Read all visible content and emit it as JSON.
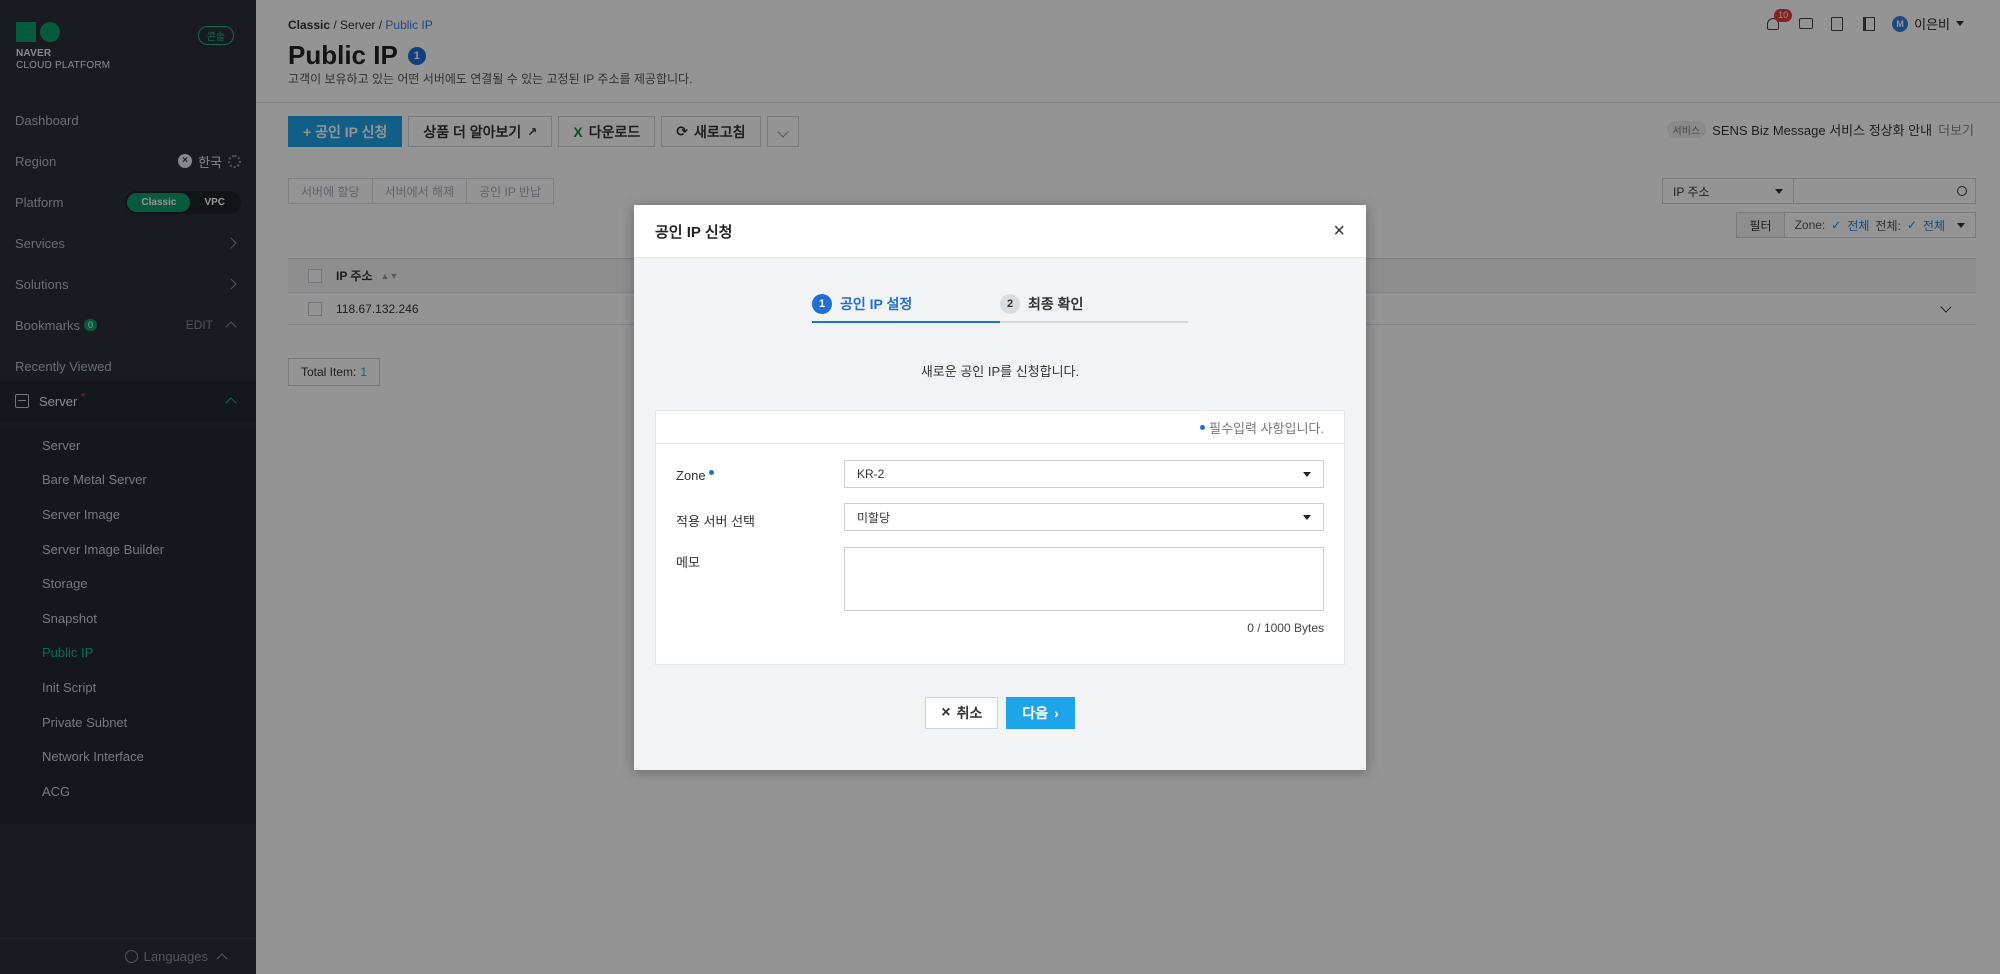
{
  "sidebar": {
    "logo_line1": "NAVER",
    "logo_line2": "CLOUD PLATFORM",
    "console_badge": "콘솔",
    "dashboard": "Dashboard",
    "region_label": "Region",
    "region_value": "한국",
    "platform_label": "Platform",
    "platform_options": [
      "Classic",
      "VPC"
    ],
    "services": "Services",
    "solutions": "Solutions",
    "bookmarks": "Bookmarks",
    "bookmarks_count": "0",
    "edit": "EDIT",
    "recently_viewed": "Recently Viewed",
    "server_group": "Server",
    "server_items": [
      "Server",
      "Bare Metal Server",
      "Server Image",
      "Server Image Builder",
      "Storage",
      "Snapshot",
      "Public IP",
      "Init Script",
      "Private Subnet",
      "Network Interface",
      "ACG"
    ],
    "active_item": "Public IP",
    "languages": "Languages"
  },
  "header": {
    "breadcrumb": [
      "Classic",
      "Server",
      "Public IP"
    ],
    "title": "Public IP",
    "title_badge": "1",
    "description": "고객이 보유하고 있는 어떤 서버에도 연결될 수 있는 고정된 IP 주소를 제공합니다.",
    "notification_count": "10",
    "user_initial": "M",
    "user_name": "이은비"
  },
  "toolbar": {
    "apply": "+ 공인 IP 신청",
    "learn_more": "상품 더 알아보기",
    "download": "다운로드",
    "refresh": "새로고침"
  },
  "notice": {
    "tag": "서비스",
    "text": "SENS Biz Message 서비스 정상화 안내",
    "more": "더보기"
  },
  "actions": [
    "서버에 할당",
    "서버에서 해제",
    "공인 IP 반납"
  ],
  "search": {
    "field": "IP 주소"
  },
  "filter": {
    "button": "필터",
    "zone_label": "Zone:",
    "zone_value": "전체",
    "all_label": "전체:",
    "all_value": "전체"
  },
  "table": {
    "header": "IP 주소",
    "rows": [
      "118.67.132.246"
    ],
    "total_label": "Total Item:",
    "total_value": "1"
  },
  "modal": {
    "title": "공인 IP 신청",
    "steps": [
      {
        "num": "1",
        "label": "공인 IP 설정"
      },
      {
        "num": "2",
        "label": "최종 확인"
      }
    ],
    "description": "새로운 공인 IP를 신청합니다.",
    "required_note": "필수입력 사항입니다.",
    "zone_label": "Zone",
    "zone_value": "KR-2",
    "server_label": "적용 서버 선택",
    "server_value": "미할당",
    "memo_label": "메모",
    "bytes": "0 / 1000 Bytes",
    "cancel": "취소",
    "next": "다음"
  }
}
